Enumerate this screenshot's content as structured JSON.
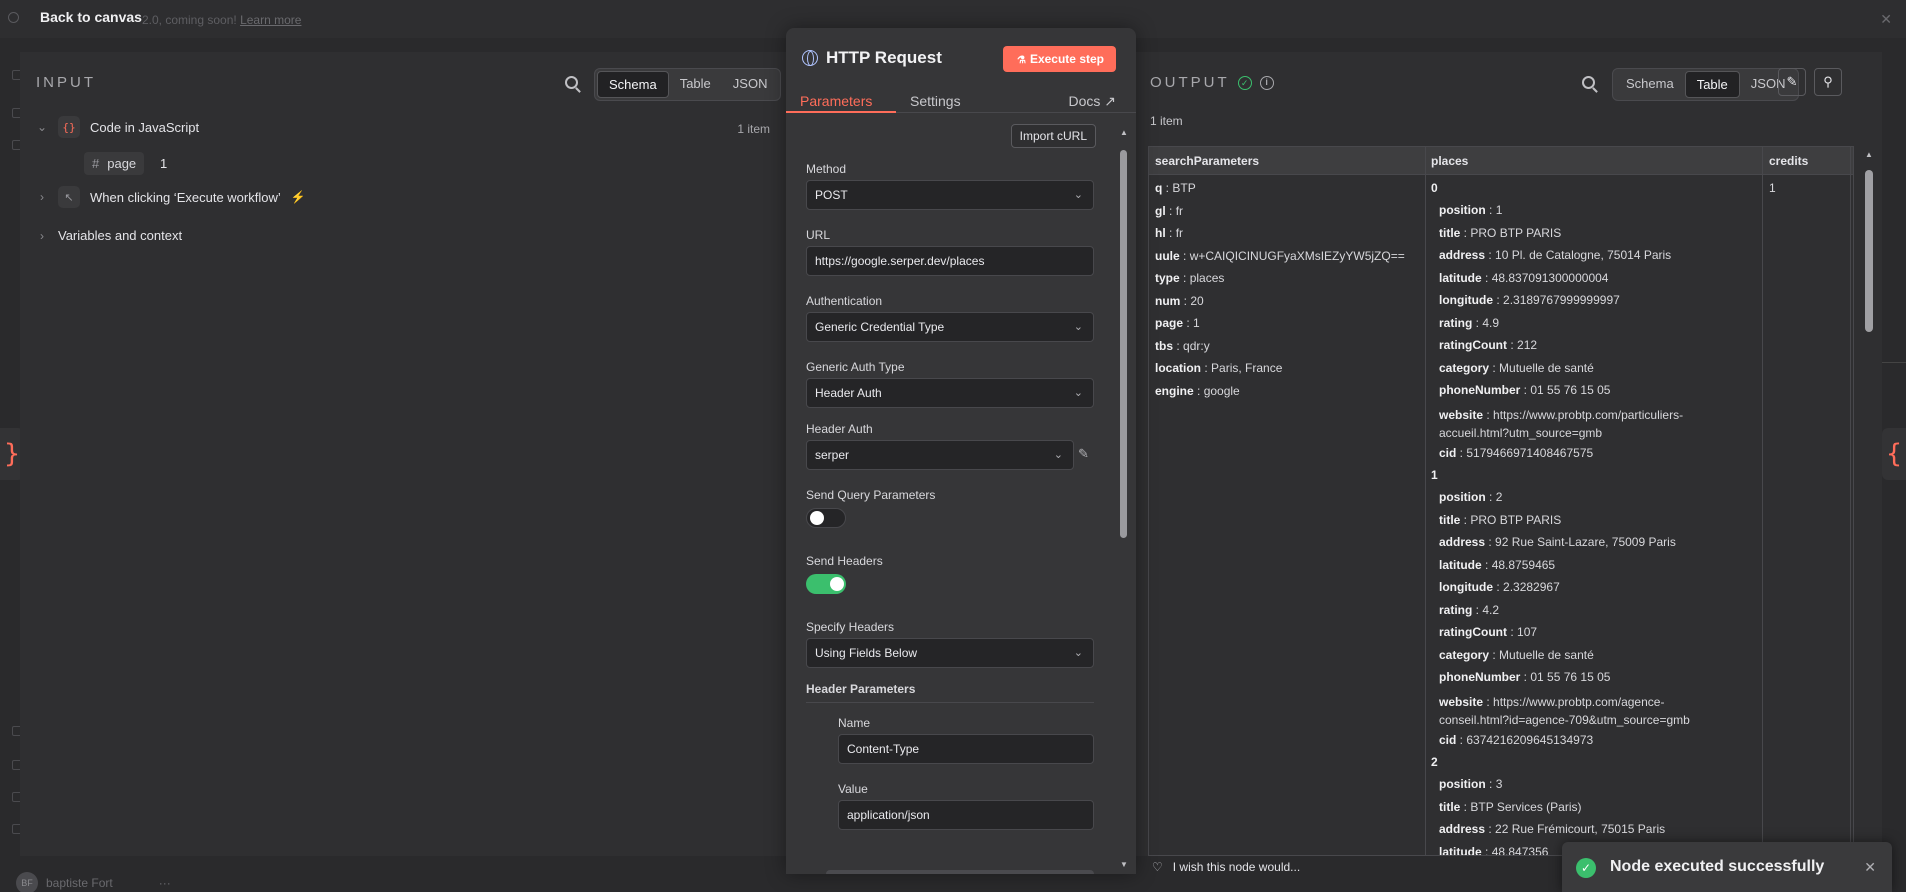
{
  "canvas": {
    "back_label": "Back to canvas",
    "notice_text": "2.0, coming soon!",
    "notice_link": "Learn more",
    "user_name": "baptiste Fort",
    "user_initials": "BF"
  },
  "input": {
    "title": "INPUT",
    "view_tabs": [
      "Schema",
      "Table",
      "JSON"
    ],
    "active_view": "Schema",
    "nodes": [
      {
        "label": "Code in JavaScript",
        "icon": "code-braces-icon",
        "items": "1 item"
      },
      {
        "label": "When clicking ‘Execute workflow’",
        "icon": "cursor-click-icon"
      },
      {
        "label": "Variables and context"
      }
    ],
    "field": {
      "name": "page",
      "value": "1"
    }
  },
  "node": {
    "title": "HTTP Request",
    "execute_label": "Execute step",
    "tabs": [
      "Parameters",
      "Settings"
    ],
    "active_tab": "Parameters",
    "docs_label": "Docs",
    "import_label": "Import cURL",
    "method": {
      "label": "Method",
      "value": "POST"
    },
    "url": {
      "label": "URL",
      "value": "https://google.serper.dev/places"
    },
    "authentication": {
      "label": "Authentication",
      "value": "Generic Credential Type"
    },
    "generic_auth_type": {
      "label": "Generic Auth Type",
      "value": "Header Auth"
    },
    "header_auth": {
      "label": "Header Auth",
      "value": "serper"
    },
    "send_query": {
      "label": "Send Query Parameters",
      "on": false
    },
    "send_headers": {
      "label": "Send Headers",
      "on": true
    },
    "specify_headers": {
      "label": "Specify Headers",
      "value": "Using Fields Below"
    },
    "header_params": {
      "label": "Header Parameters",
      "name_label": "Name",
      "name_value": "Content-Type",
      "value_label": "Value",
      "value_value": "application/json"
    }
  },
  "output": {
    "title": "OUTPUT",
    "view_tabs": [
      "Schema",
      "Table",
      "JSON"
    ],
    "active_view": "Table",
    "count": "1 item",
    "columns": [
      "searchParameters",
      "places",
      "credits"
    ],
    "search_parameters": [
      {
        "k": "q",
        "v": "BTP"
      },
      {
        "k": "gl",
        "v": "fr"
      },
      {
        "k": "hl",
        "v": "fr"
      },
      {
        "k": "uule",
        "v": "w+CAIQICINUGFyaXMsIEZyYW5jZQ=="
      },
      {
        "k": "type",
        "v": "places"
      },
      {
        "k": "num",
        "v": "20"
      },
      {
        "k": "page",
        "v": "1"
      },
      {
        "k": "tbs",
        "v": "qdr:y"
      },
      {
        "k": "location",
        "v": "Paris, France"
      },
      {
        "k": "engine",
        "v": "google"
      }
    ],
    "credits": "1",
    "places": [
      {
        "index": "0",
        "fields": [
          {
            "k": "position",
            "v": "1"
          },
          {
            "k": "title",
            "v": "PRO BTP PARIS"
          },
          {
            "k": "address",
            "v": "10 Pl. de Catalogne, 75014 Paris"
          },
          {
            "k": "latitude",
            "v": "48.837091300000004"
          },
          {
            "k": "longitude",
            "v": "2.3189767999999997"
          },
          {
            "k": "rating",
            "v": "4.9"
          },
          {
            "k": "ratingCount",
            "v": "212"
          },
          {
            "k": "category",
            "v": "Mutuelle de santé"
          },
          {
            "k": "phoneNumber",
            "v": "01 55 76 15 05"
          },
          {
            "k": "website",
            "v": "https://www.probtp.com/particuliers-accueil.html?utm_source=gmb"
          },
          {
            "k": "cid",
            "v": "5179466971408467575"
          }
        ]
      },
      {
        "index": "1",
        "fields": [
          {
            "k": "position",
            "v": "2"
          },
          {
            "k": "title",
            "v": "PRO BTP PARIS"
          },
          {
            "k": "address",
            "v": "92 Rue Saint-Lazare, 75009 Paris"
          },
          {
            "k": "latitude",
            "v": "48.8759465"
          },
          {
            "k": "longitude",
            "v": "2.3282967"
          },
          {
            "k": "rating",
            "v": "4.2"
          },
          {
            "k": "ratingCount",
            "v": "107"
          },
          {
            "k": "category",
            "v": "Mutuelle de santé"
          },
          {
            "k": "phoneNumber",
            "v": "01 55 76 15 05"
          },
          {
            "k": "website",
            "v": "https://www.probtp.com/agence-conseil.html?id=agence-709&utm_source=gmb"
          },
          {
            "k": "cid",
            "v": "6374216209645134973"
          }
        ]
      },
      {
        "index": "2",
        "fields": [
          {
            "k": "position",
            "v": "3"
          },
          {
            "k": "title",
            "v": "BTP Services (Paris)"
          },
          {
            "k": "address",
            "v": "22 Rue Frémicourt, 75015 Paris"
          },
          {
            "k": "latitude",
            "v": "48.847356"
          }
        ]
      }
    ],
    "wish_text": "I wish this node would..."
  },
  "toast": {
    "message": "Node executed successfully"
  },
  "colors": {
    "accent": "#ff6d5a",
    "success": "#3bbf6d"
  }
}
